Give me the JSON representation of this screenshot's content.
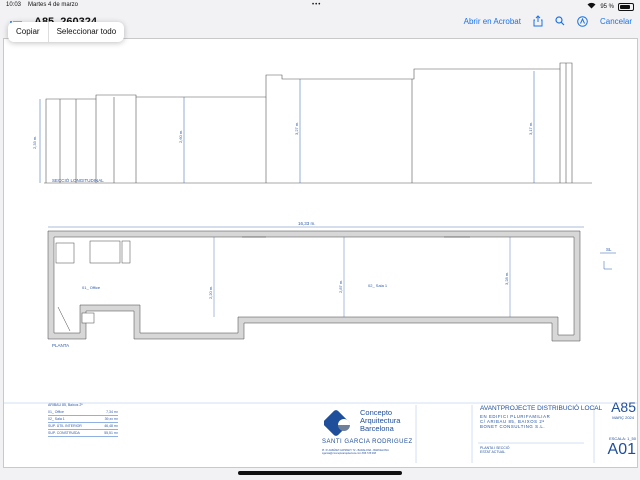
{
  "status_bar": {
    "time": "10:03",
    "date": "Martes 4 de marzo",
    "multitask_dots": "•••",
    "battery_percent": "95 %",
    "battery_level": 0.95
  },
  "toolbar": {
    "title": "A85_260324",
    "open_in_acrobat": "Abrir en Acrobat",
    "cancel": "Cancelar"
  },
  "context_menu": {
    "copy": "Copiar",
    "select_all": "Seleccionar todo"
  },
  "drawing": {
    "section_label": "SECCIÓ LONGITUDINAL",
    "plan_label": "PLANTA",
    "section_heights": [
      "2,33 m.",
      "2,60 m.",
      "3,27 m.",
      "3,17 m."
    ],
    "plan_width": "16,33 m.",
    "plan_heights": [
      "2,20 m.",
      "2,87 m.",
      "3,28 m."
    ],
    "room_office": "01_ Office",
    "room_sala": "02_ Sala 1",
    "section_marker": "SL"
  },
  "area_table": {
    "header": "ARIBAU 85, Baixos 2ª",
    "rows": [
      {
        "label": "01_ Office",
        "value": "7,34 m²"
      },
      {
        "label": "02_ Sala 1",
        "value": "39,xx m²"
      },
      {
        "label": "SUP. ÚTIL INTERIOR",
        "value": "46,48 m²"
      },
      {
        "label": "SUP. CONSTRUÏDA",
        "value": "55,51 m²"
      }
    ]
  },
  "logo": {
    "line1": "Concepto",
    "line2": "Arquitectura",
    "line3": "Barcelona",
    "name": "SANTI GARCIA RODRIGUEZ",
    "address": "Pl. 6ª ALBÉNIZ CAPMANY 72 - BADALONA - BARCELONA",
    "contact": "sgarcia@conceptoarquitectura.com   656 725 098"
  },
  "title_block": {
    "title": "AVANTPROJECTE DISTRIBUCIÓ LOCAL",
    "line1": "EN EDIFICI PLURIFAMILIAR",
    "line2": "C/ ARIBAU 85, BAIXOS 2ª",
    "line3": "BONET CONSULTING S.L.",
    "code": "A85",
    "date": "MARÇ 2024",
    "scale": "ESCALA: 1_50",
    "sheet": "A01",
    "plan_name": "PLANTA I SECCIÓ",
    "state": "ESTAT ACTUAL"
  },
  "colors": {
    "accent": "#1a73e8",
    "drawing_blue": "#2d5aa8",
    "wall_fill": "#d7d7d7"
  }
}
